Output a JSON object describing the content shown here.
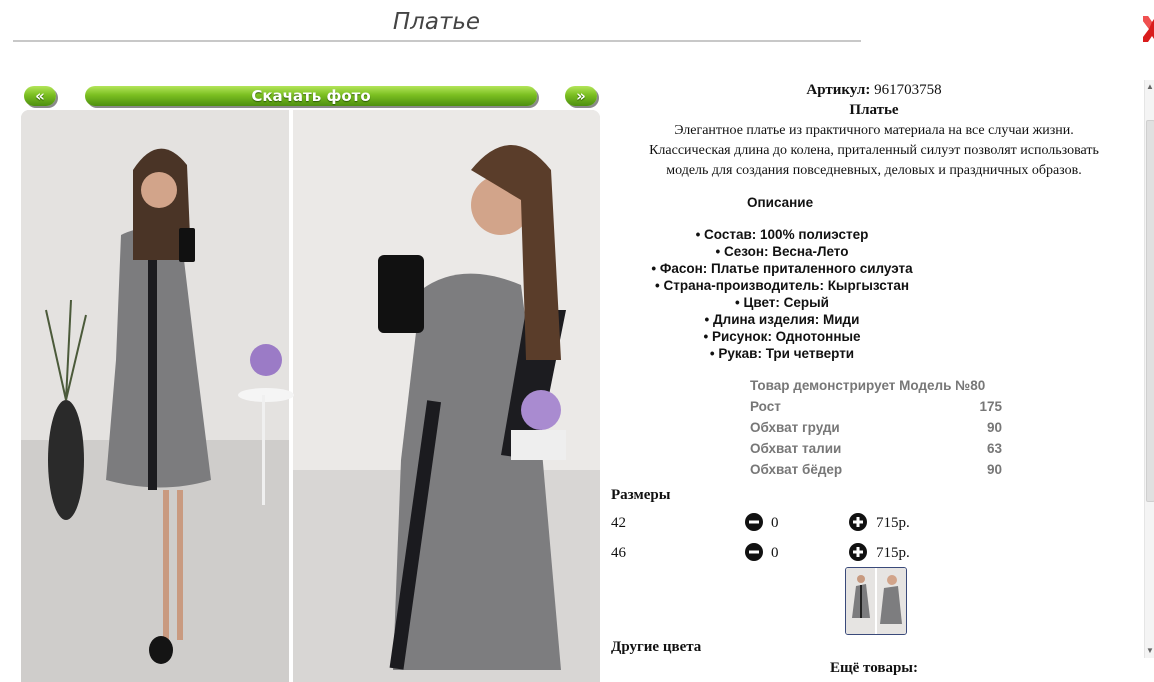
{
  "page": {
    "title": "Платье"
  },
  "gallery": {
    "prev_label": "«",
    "download_label": "Скачать фото",
    "next_label": "»"
  },
  "product": {
    "sku_label": "Артикул:",
    "sku_value": "961703758",
    "name": "Платье",
    "description_lines": [
      "Элегантное платье из практичного материала на все случаи жизни.",
      "Классическая длина до колена, приталенный силуэт позволят использовать",
      "модель для создания повседневных, деловых и праздничных образов."
    ],
    "description_title": "Описание",
    "properties": [
      "• Состав: 100% полиэстер",
      "• Сезон: Весна-Лето",
      "• Фасон: Платье приталенного силуэта",
      "• Страна-производитель: Кыргызстан",
      "• Цвет: Серый",
      "• Длина изделия: Миди",
      "• Рисунок: Однотонные",
      "• Рукав: Три четверти"
    ],
    "model": {
      "title": "Товар демонстрирует Модель №80",
      "rows": [
        {
          "label": "Рост",
          "value": "175"
        },
        {
          "label": "Обхват груди",
          "value": "90"
        },
        {
          "label": "Обхват талии",
          "value": "63"
        },
        {
          "label": "Обхват бёдер",
          "value": "90"
        }
      ]
    },
    "sizes_title": "Размеры",
    "sizes": [
      {
        "size": "42",
        "qty": "0",
        "price": "715р."
      },
      {
        "size": "46",
        "qty": "0",
        "price": "715р."
      }
    ],
    "other_colors_label": "Другие цвета",
    "more_goods_label": "Ещё товары:"
  },
  "colors": {
    "accent_green": "#7bbf21",
    "close_red": "#d91c1c",
    "model_text": "#777777"
  },
  "icons": {
    "close": "close-icon",
    "minus": "minus-circle-icon",
    "plus": "plus-circle-icon"
  }
}
